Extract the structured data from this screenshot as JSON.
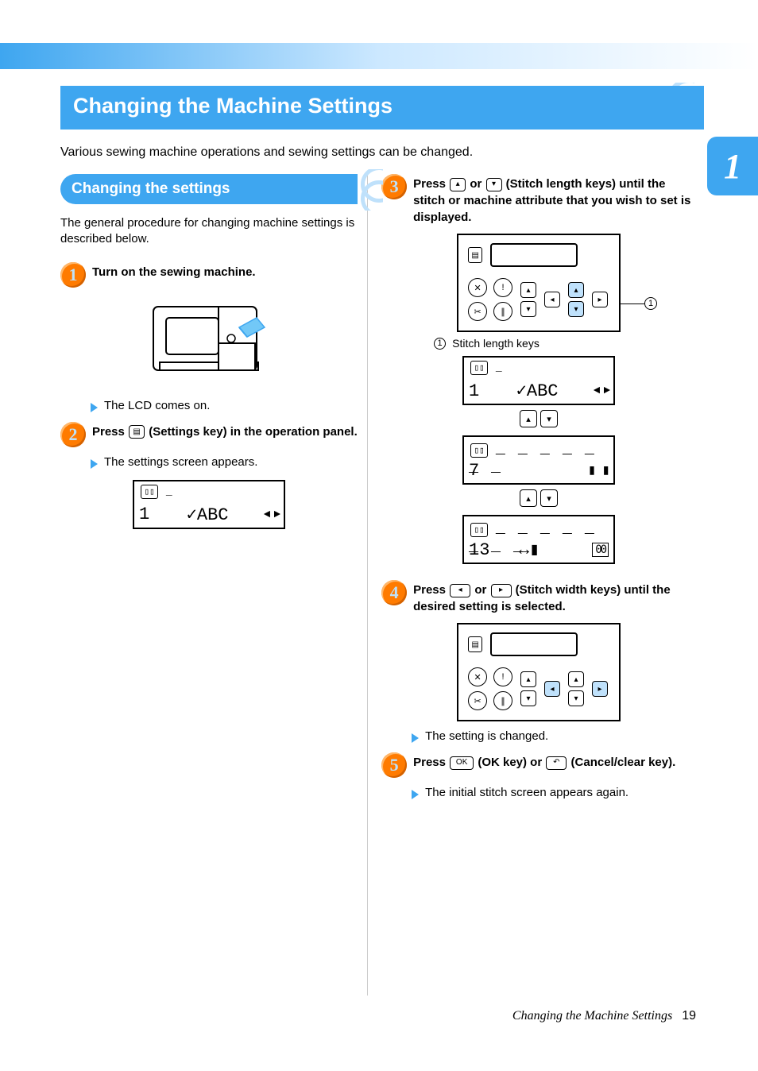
{
  "chapter_tab": "1",
  "main_title": "Changing the Machine Settings",
  "intro": "Various sewing machine operations and sewing settings can be changed.",
  "sub_heading": "Changing the settings",
  "sub_text": "The general procedure for changing machine settings is described below.",
  "steps": {
    "s1": {
      "num": "1",
      "text": "Turn on the sewing machine."
    },
    "s1_result": "The LCD comes on.",
    "s2": {
      "num": "2",
      "pre": "Press ",
      "key": "(Settings key)",
      "post": " in the operation panel."
    },
    "s2_result": "The settings screen appears.",
    "s3": {
      "num": "3",
      "pre": "Press ",
      "or": " or ",
      "post": " (Stitch length keys) until the stitch or machine attribute that you wish to set is displayed."
    },
    "s3_callout": "Stitch length keys",
    "s4": {
      "num": "4",
      "pre": "Press ",
      "or": " or ",
      "post": " (Stitch width keys) until the desired setting is selected."
    },
    "s4_result": "The setting is changed.",
    "s5": {
      "num": "5",
      "pre": "Press ",
      "oklabel": "OK",
      "mid": " (OK key) or ",
      "post": " (Cancel/clear key)."
    },
    "s5_result": "The initial stitch screen appears again."
  },
  "lcd": {
    "index1": "1",
    "content1": "✓ABC",
    "arrows": "◄ ►",
    "index7": "7",
    "index13": "13",
    "counter13": "00"
  },
  "footer": {
    "title": "Changing the Machine Settings",
    "page": "19"
  }
}
